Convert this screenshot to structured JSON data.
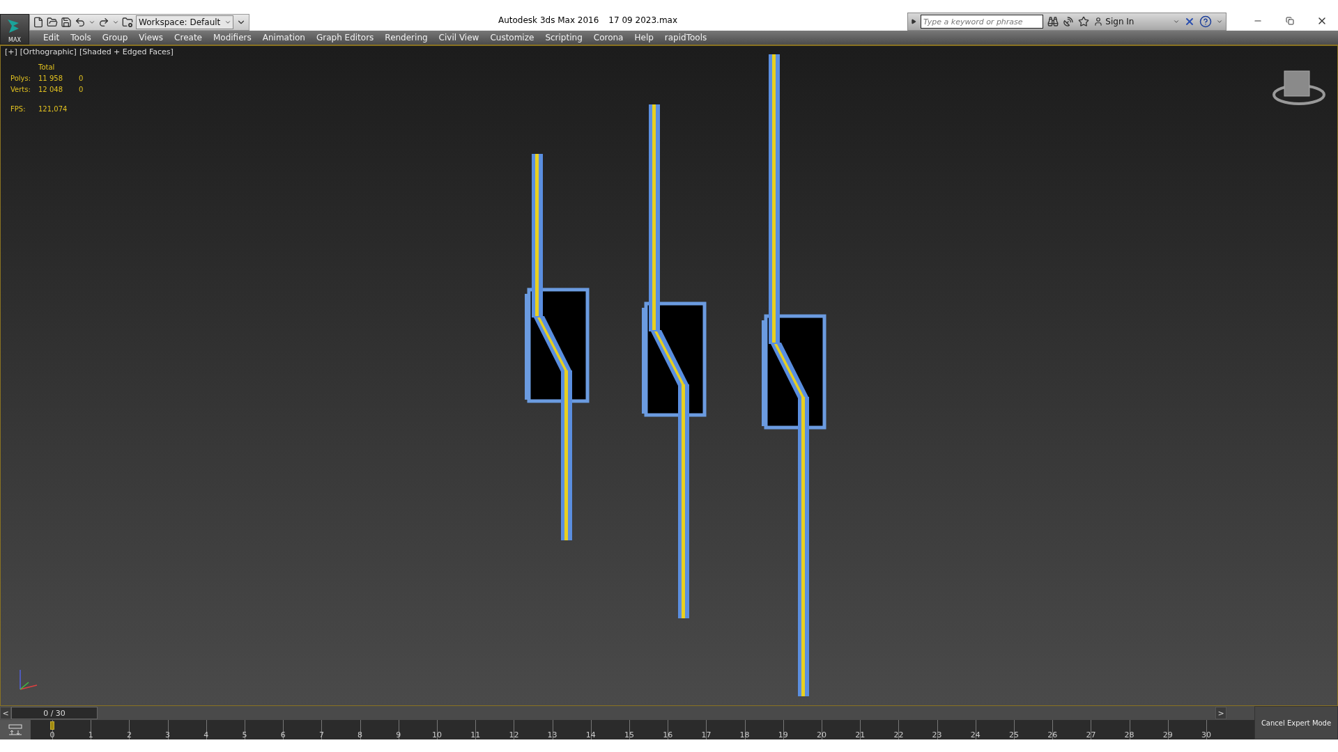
{
  "app": {
    "logo": "MAX",
    "title": "Autodesk 3ds Max 2016",
    "file": "17 09 2023.max"
  },
  "quick_access": {
    "workspace": "Workspace: Default"
  },
  "infocenter": {
    "search": {
      "placeholder": "Type a keyword or phrase"
    },
    "sign_in": "Sign In"
  },
  "menu": [
    "Edit",
    "Tools",
    "Group",
    "Views",
    "Create",
    "Modifiers",
    "Animation",
    "Graph Editors",
    "Rendering",
    "Civil View",
    "Customize",
    "Scripting",
    "Corona",
    "Help",
    "rapidTools"
  ],
  "viewport": {
    "labels": [
      "[+]",
      "[Orthographic]",
      "[Shaded + Edged Faces]"
    ],
    "stats": {
      "header": "Total",
      "rows": [
        {
          "label": "Polys:",
          "total": "11 958",
          "selection": "0"
        },
        {
          "label": "Verts:",
          "total": "12 048",
          "selection": "0"
        }
      ],
      "fps_label": "FPS:",
      "fps": "121,074"
    }
  },
  "time_slider": {
    "prev": "<",
    "frame": "0 / 30",
    "next": ">",
    "level": 0
  },
  "track_bar": {
    "ticks": [
      "0",
      "1",
      "2",
      "3",
      "4",
      "5",
      "6",
      "7",
      "8",
      "9",
      "10",
      "11",
      "12",
      "13",
      "14",
      "15",
      "16",
      "17",
      "18",
      "19",
      "20",
      "21",
      "22",
      "23",
      "24",
      "25",
      "26",
      "27",
      "28",
      "29",
      "30"
    ]
  },
  "status": {
    "cancel_expert": "Cancel Expert Mode"
  }
}
